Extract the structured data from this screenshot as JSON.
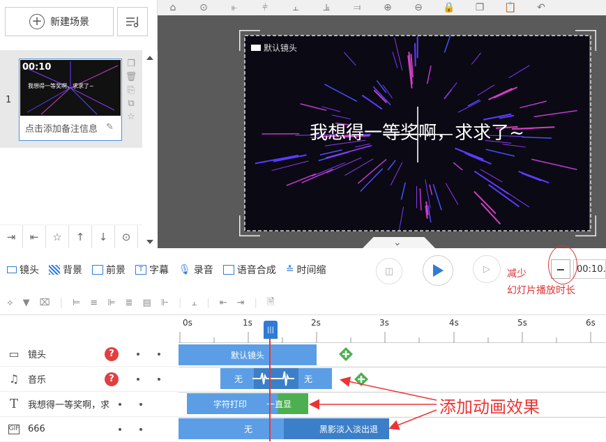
{
  "scene_panel": {
    "new_scene_label": "新建场景",
    "scene_number": "1",
    "thumb_time": "00:10",
    "thumb_caption": "我想得一等奖啊，求求了~",
    "note_placeholder": "点击添加备注信息"
  },
  "canvas": {
    "camera_label": "默认镜头",
    "main_text": "我想得一等奖啊，求求了~"
  },
  "toolbar": {
    "items": [
      "镜头",
      "背景",
      "前景",
      "字幕",
      "录音",
      "语音合成",
      "时间缩"
    ],
    "duration": "00:10.",
    "annotation_line1": "减少",
    "annotation_line2": "幻灯片播放时长"
  },
  "timeline": {
    "ticks": [
      "0s",
      "1s",
      "2s",
      "3s",
      "4s",
      "5s",
      "6s"
    ],
    "tracks": [
      {
        "name": "镜头",
        "icon": "camera-icon"
      },
      {
        "name": "音乐",
        "icon": "music-icon"
      },
      {
        "name": "我想得一等奖啊，求",
        "icon": "text-icon"
      },
      {
        "name": "666",
        "icon": "gif-icon"
      }
    ],
    "clips": {
      "camera": "默认镜头",
      "music_left": "无",
      "music_right": "无",
      "text_enter": "字符打印",
      "text_stay": "一直显",
      "gif_enter": "无",
      "gif_exit": "黑影淡入淡出退"
    },
    "annotation": "添加动画效果"
  },
  "colors": {
    "accent": "#2f7bd6",
    "clip_blue": "#5b9ee6",
    "annotation_red": "#e33333",
    "green": "#4caf50"
  }
}
